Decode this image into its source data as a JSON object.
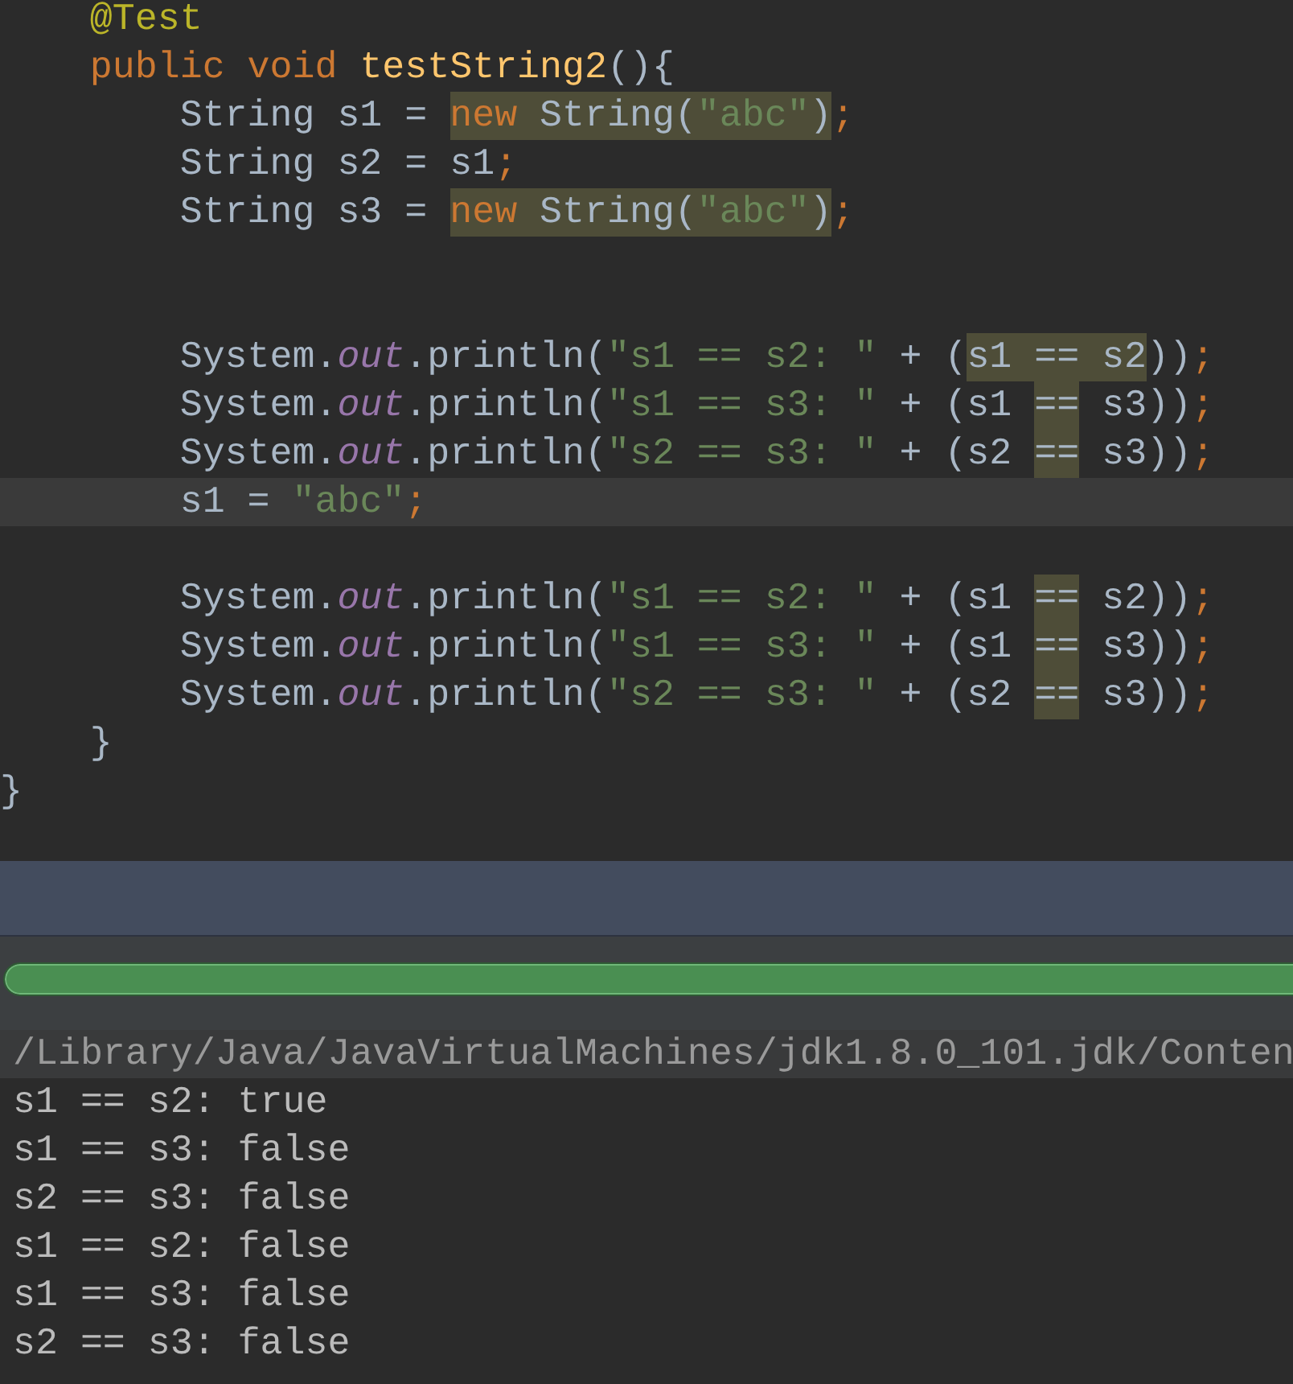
{
  "editor": {
    "lines": [
      {
        "kind": "code",
        "current": false,
        "segments": [
          {
            "text": "    @Test",
            "kind": "annotation",
            "highlighted": false
          }
        ]
      },
      {
        "kind": "code",
        "current": false,
        "segments": [
          {
            "text": "    public void ",
            "kind": "keyword",
            "highlighted": false
          },
          {
            "text": "testString2",
            "kind": "method",
            "highlighted": false
          },
          {
            "text": "(){",
            "kind": "plain",
            "highlighted": false
          }
        ]
      },
      {
        "kind": "code",
        "current": false,
        "segments": [
          {
            "text": "        String s1 = ",
            "kind": "plain",
            "highlighted": false
          },
          {
            "text": "new",
            "kind": "keyword",
            "highlighted": true
          },
          {
            "text": " String(",
            "kind": "plain",
            "highlighted": true
          },
          {
            "text": "\"abc\"",
            "kind": "string",
            "highlighted": true
          },
          {
            "text": ")",
            "kind": "plain",
            "highlighted": true
          },
          {
            "text": ";",
            "kind": "keyword",
            "highlighted": false
          }
        ]
      },
      {
        "kind": "code",
        "current": false,
        "segments": [
          {
            "text": "        String s2 = s1",
            "kind": "plain",
            "highlighted": false
          },
          {
            "text": ";",
            "kind": "keyword",
            "highlighted": false
          }
        ]
      },
      {
        "kind": "code",
        "current": false,
        "segments": [
          {
            "text": "        String s3 = ",
            "kind": "plain",
            "highlighted": false
          },
          {
            "text": "new",
            "kind": "keyword",
            "highlighted": true
          },
          {
            "text": " String(",
            "kind": "plain",
            "highlighted": true
          },
          {
            "text": "\"abc\"",
            "kind": "string",
            "highlighted": true
          },
          {
            "text": ")",
            "kind": "plain",
            "highlighted": true
          },
          {
            "text": ";",
            "kind": "keyword",
            "highlighted": false
          }
        ]
      },
      {
        "kind": "blank",
        "current": false
      },
      {
        "kind": "blank",
        "current": false
      },
      {
        "kind": "code",
        "current": false,
        "segments": [
          {
            "text": "        System.",
            "kind": "plain",
            "highlighted": false
          },
          {
            "text": "out",
            "kind": "field",
            "highlighted": false
          },
          {
            "text": ".println(",
            "kind": "plain",
            "highlighted": false
          },
          {
            "text": "\"s1 == s2: \"",
            "kind": "string",
            "highlighted": false
          },
          {
            "text": " + (",
            "kind": "plain",
            "highlighted": false
          },
          {
            "text": "s1 == s2",
            "kind": "plain",
            "highlighted": true
          },
          {
            "text": "))",
            "kind": "plain",
            "highlighted": false
          },
          {
            "text": ";",
            "kind": "keyword",
            "highlighted": false
          }
        ]
      },
      {
        "kind": "code",
        "current": false,
        "segments": [
          {
            "text": "        System.",
            "kind": "plain",
            "highlighted": false
          },
          {
            "text": "out",
            "kind": "field",
            "highlighted": false
          },
          {
            "text": ".println(",
            "kind": "plain",
            "highlighted": false
          },
          {
            "text": "\"s1 == s3: \"",
            "kind": "string",
            "highlighted": false
          },
          {
            "text": " + (s1 ",
            "kind": "plain",
            "highlighted": false
          },
          {
            "text": "==",
            "kind": "plain",
            "highlighted": true
          },
          {
            "text": " s3))",
            "kind": "plain",
            "highlighted": false
          },
          {
            "text": ";",
            "kind": "keyword",
            "highlighted": false
          }
        ]
      },
      {
        "kind": "code",
        "current": false,
        "segments": [
          {
            "text": "        System.",
            "kind": "plain",
            "highlighted": false
          },
          {
            "text": "out",
            "kind": "field",
            "highlighted": false
          },
          {
            "text": ".println(",
            "kind": "plain",
            "highlighted": false
          },
          {
            "text": "\"s2 == s3: \"",
            "kind": "string",
            "highlighted": false
          },
          {
            "text": " + (s2 ",
            "kind": "plain",
            "highlighted": false
          },
          {
            "text": "==",
            "kind": "plain",
            "highlighted": true
          },
          {
            "text": " s3))",
            "kind": "plain",
            "highlighted": false
          },
          {
            "text": ";",
            "kind": "keyword",
            "highlighted": false
          }
        ]
      },
      {
        "kind": "code",
        "current": true,
        "segments": [
          {
            "text": "        s1 = ",
            "kind": "plain",
            "highlighted": false
          },
          {
            "text": "\"abc\"",
            "kind": "string",
            "highlighted": false
          },
          {
            "text": ";",
            "kind": "keyword",
            "highlighted": false
          }
        ]
      },
      {
        "kind": "blank",
        "current": false
      },
      {
        "kind": "code",
        "current": false,
        "segments": [
          {
            "text": "        System.",
            "kind": "plain",
            "highlighted": false
          },
          {
            "text": "out",
            "kind": "field",
            "highlighted": false
          },
          {
            "text": ".println(",
            "kind": "plain",
            "highlighted": false
          },
          {
            "text": "\"s1 == s2: \"",
            "kind": "string",
            "highlighted": false
          },
          {
            "text": " + (s1 ",
            "kind": "plain",
            "highlighted": false
          },
          {
            "text": "==",
            "kind": "plain",
            "highlighted": true
          },
          {
            "text": " s2))",
            "kind": "plain",
            "highlighted": false
          },
          {
            "text": ";",
            "kind": "keyword",
            "highlighted": false
          }
        ]
      },
      {
        "kind": "code",
        "current": false,
        "segments": [
          {
            "text": "        System.",
            "kind": "plain",
            "highlighted": false
          },
          {
            "text": "out",
            "kind": "field",
            "highlighted": false
          },
          {
            "text": ".println(",
            "kind": "plain",
            "highlighted": false
          },
          {
            "text": "\"s1 == s3: \"",
            "kind": "string",
            "highlighted": false
          },
          {
            "text": " + (s1 ",
            "kind": "plain",
            "highlighted": false
          },
          {
            "text": "==",
            "kind": "plain",
            "highlighted": true
          },
          {
            "text": " s3))",
            "kind": "plain",
            "highlighted": false
          },
          {
            "text": ";",
            "kind": "keyword",
            "highlighted": false
          }
        ]
      },
      {
        "kind": "code",
        "current": false,
        "segments": [
          {
            "text": "        System.",
            "kind": "plain",
            "highlighted": false
          },
          {
            "text": "out",
            "kind": "field",
            "highlighted": false
          },
          {
            "text": ".println(",
            "kind": "plain",
            "highlighted": false
          },
          {
            "text": "\"s2 == s3: \"",
            "kind": "string",
            "highlighted": false
          },
          {
            "text": " + (s2 ",
            "kind": "plain",
            "highlighted": false
          },
          {
            "text": "==",
            "kind": "plain",
            "highlighted": true
          },
          {
            "text": " s3))",
            "kind": "plain",
            "highlighted": false
          },
          {
            "text": ";",
            "kind": "keyword",
            "highlighted": false
          }
        ]
      },
      {
        "kind": "code",
        "current": false,
        "segments": [
          {
            "text": "    }",
            "kind": "plain",
            "highlighted": false
          }
        ]
      },
      {
        "kind": "code",
        "current": false,
        "segments": [
          {
            "text": "}",
            "kind": "plain",
            "highlighted": false
          }
        ]
      }
    ]
  },
  "test_progress": {
    "level": 1
  },
  "console": {
    "lines": [
      {
        "kind": "command",
        "text": "/Library/Java/JavaVirtualMachines/jdk1.8.0_101.jdk/Conten"
      },
      {
        "kind": "output",
        "text": "s1 == s2: true"
      },
      {
        "kind": "output",
        "text": "s1 == s3: false"
      },
      {
        "kind": "output",
        "text": "s2 == s3: false"
      },
      {
        "kind": "output",
        "text": "s1 == s2: false"
      },
      {
        "kind": "output",
        "text": "s1 == s3: false"
      },
      {
        "kind": "output",
        "text": "s2 == s3: false"
      }
    ]
  }
}
